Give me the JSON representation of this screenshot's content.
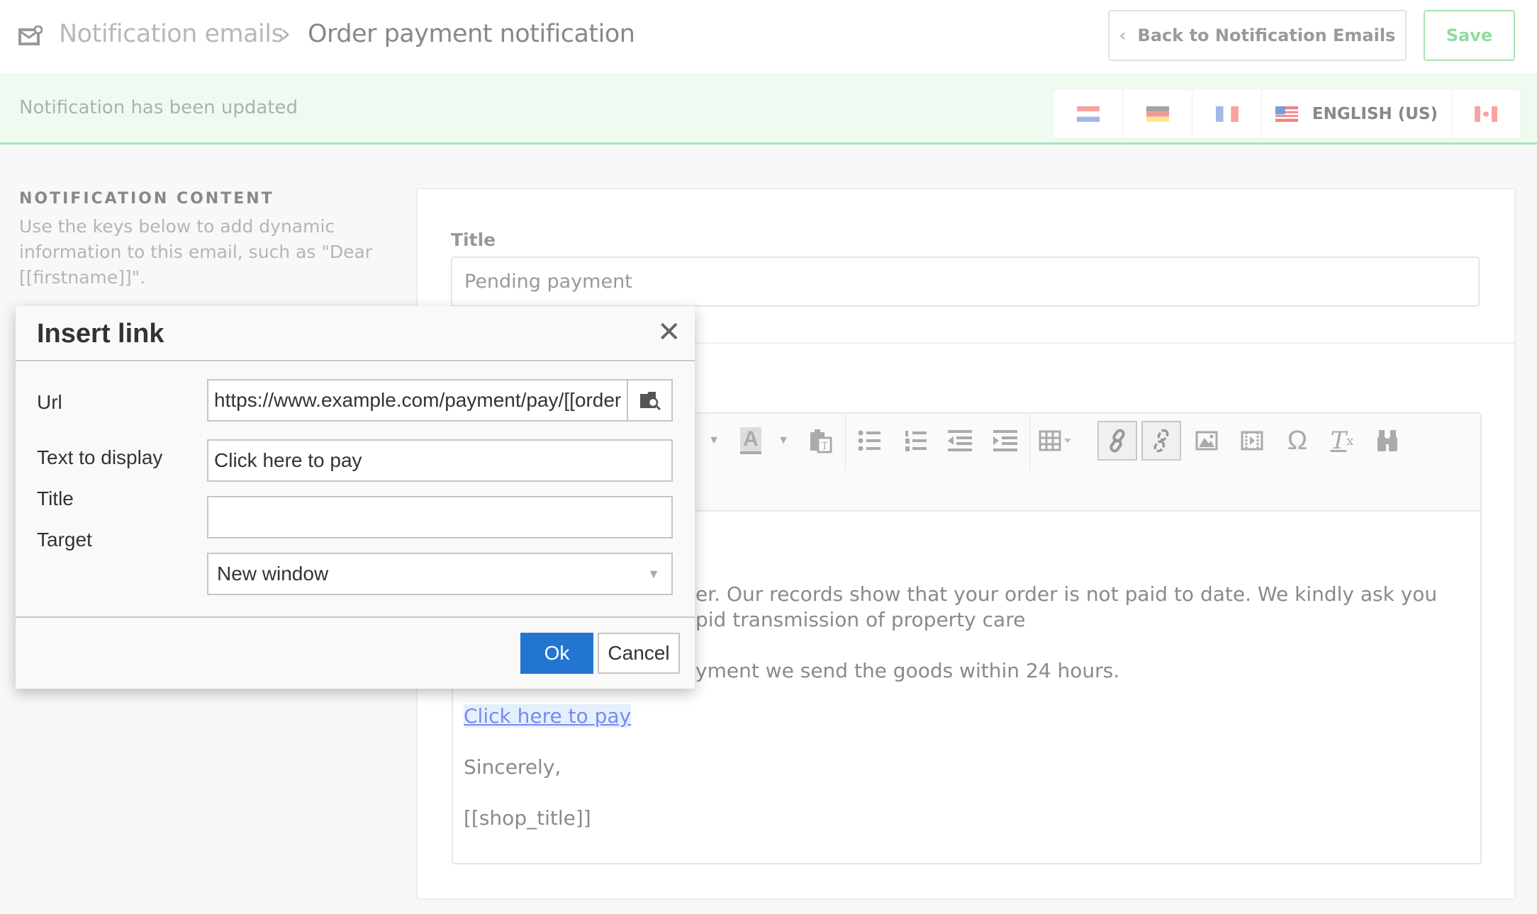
{
  "header": {
    "breadcrumb_root": "Notification emails",
    "breadcrumb_current": "Order payment notification",
    "back_label": "Back to Notification Emails",
    "save_label": "Save",
    "icon": "mail-check-icon"
  },
  "banner": {
    "message": "Notification has been updated"
  },
  "languages": [
    {
      "flag": "nl"
    },
    {
      "flag": "de"
    },
    {
      "flag": "fr"
    },
    {
      "flag": "us",
      "label": "ENGLISH (US)",
      "active": true
    },
    {
      "flag": "ca"
    }
  ],
  "sidebar": {
    "heading": "NOTIFICATION CONTENT",
    "description": "Use the keys below to add dynamic information to this email, such as \"Dear [[firstname]]\"."
  },
  "form": {
    "title_label": "Title",
    "title_value": "Pending payment"
  },
  "toolbar": {
    "icons": [
      "caret-down-icon",
      "text-color-icon",
      "paste-text-icon",
      "bullet-list-icon",
      "numbered-list-icon",
      "outdent-icon",
      "indent-icon",
      "table-icon",
      "link-icon",
      "unlink-icon",
      "image-icon",
      "media-icon",
      "special-char-icon",
      "clear-format-icon",
      "find-replace-icon"
    ]
  },
  "editor": {
    "line1": "er. Our records show that your order is not paid to date. We kindly ask you",
    "line2": "pid transmission of property care",
    "line3": "yment we send the goods within 24 hours.",
    "link": "Click here to pay",
    "closing": "Sincerely,",
    "signature": "[[shop_title]]"
  },
  "dialog": {
    "title": "Insert link",
    "url_label": "Url",
    "url_value": "https://www.example.com/payment/pay/[[order",
    "text_label": "Text to display",
    "text_value": "Click here to pay",
    "title_label": "Title",
    "title_value": "",
    "target_label": "Target",
    "target_value": "New window",
    "ok_label": "Ok",
    "cancel_label": "Cancel"
  },
  "colors": {
    "accent": "#2276d2",
    "success": "#a8e4b4",
    "link": "#6b7cf0"
  }
}
